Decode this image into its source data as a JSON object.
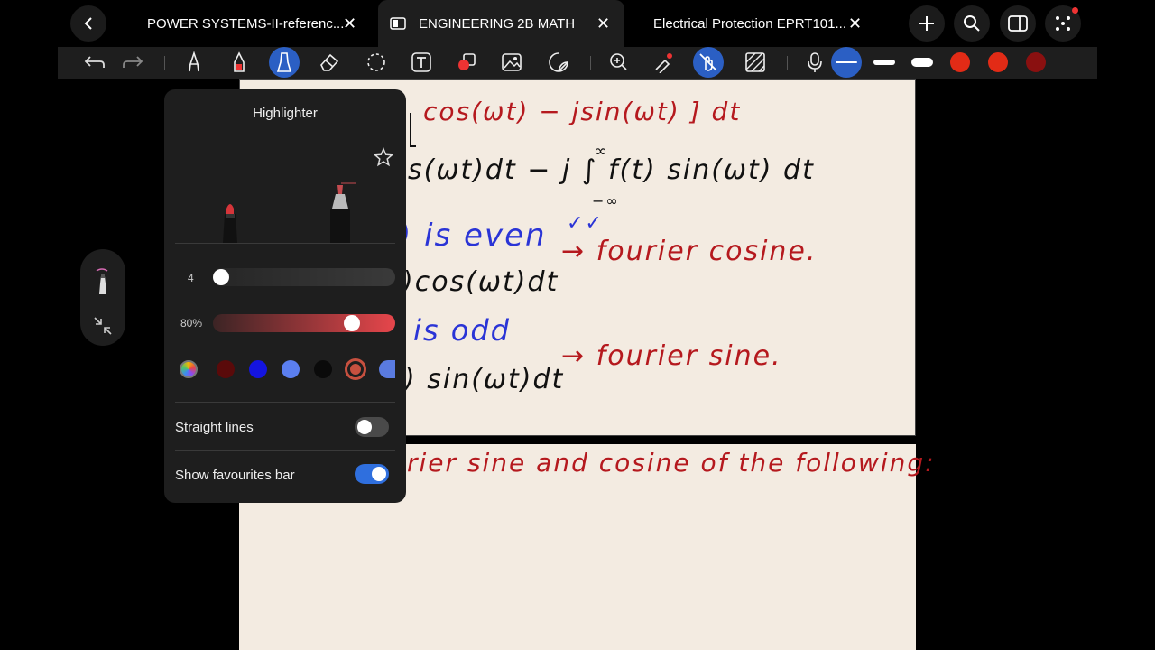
{
  "tabs": [
    {
      "label": "POWER SYSTEMS-II-referenc...",
      "active": false
    },
    {
      "label": "ENGINEERING 2B MATH",
      "active": true
    },
    {
      "label": "Electrical Protection EPRT101...",
      "active": false
    }
  ],
  "icons": {
    "back": "chevron-left-icon",
    "close": "close-icon",
    "add": "plus-icon",
    "search": "search-icon",
    "sidebar": "sidebar-icon",
    "more": "grid-dots-icon"
  },
  "colors": {
    "accent": "#2b5fc4",
    "ink_red": "#b5191e",
    "ink_blue": "#2a34d6",
    "paper": "#f3ebe1",
    "toolbar_red": "#e22b16",
    "toolbar_darkred": "#8a1010"
  },
  "notes": {
    "line1": "cos(ωt) − jsin(ωt) ] dt",
    "line2": "s(ωt)dt − j ∫ f(t) sin(ωt) dt",
    "line2_upper": "∞",
    "line2_lower": "−∞",
    "line3": ") is even",
    "line3_ticks": "✓✓",
    "line4": ")cos(ωt)dt",
    "line4_arrow": "→ fourier cosine.",
    "line5": "is odd",
    "line6": ") sin(ωt)dt",
    "line6_arrow": "→ fourier sine.",
    "page2": "rier sine and cosine of the following:"
  },
  "panel": {
    "title": "Highlighter",
    "size_value": "4",
    "size_fraction": 0.05,
    "opacity_value": "80%",
    "opacity_fraction": 0.8,
    "swatches": [
      "rainbow",
      "#5a0a0a",
      "#1414e0",
      "#5b7ff0",
      "#0a0a0a",
      "#c7503f",
      "#5a7be0"
    ],
    "straight_lines_label": "Straight lines",
    "straight_lines_on": false,
    "favourites_label": "Show favourites bar",
    "favourites_on": true
  }
}
